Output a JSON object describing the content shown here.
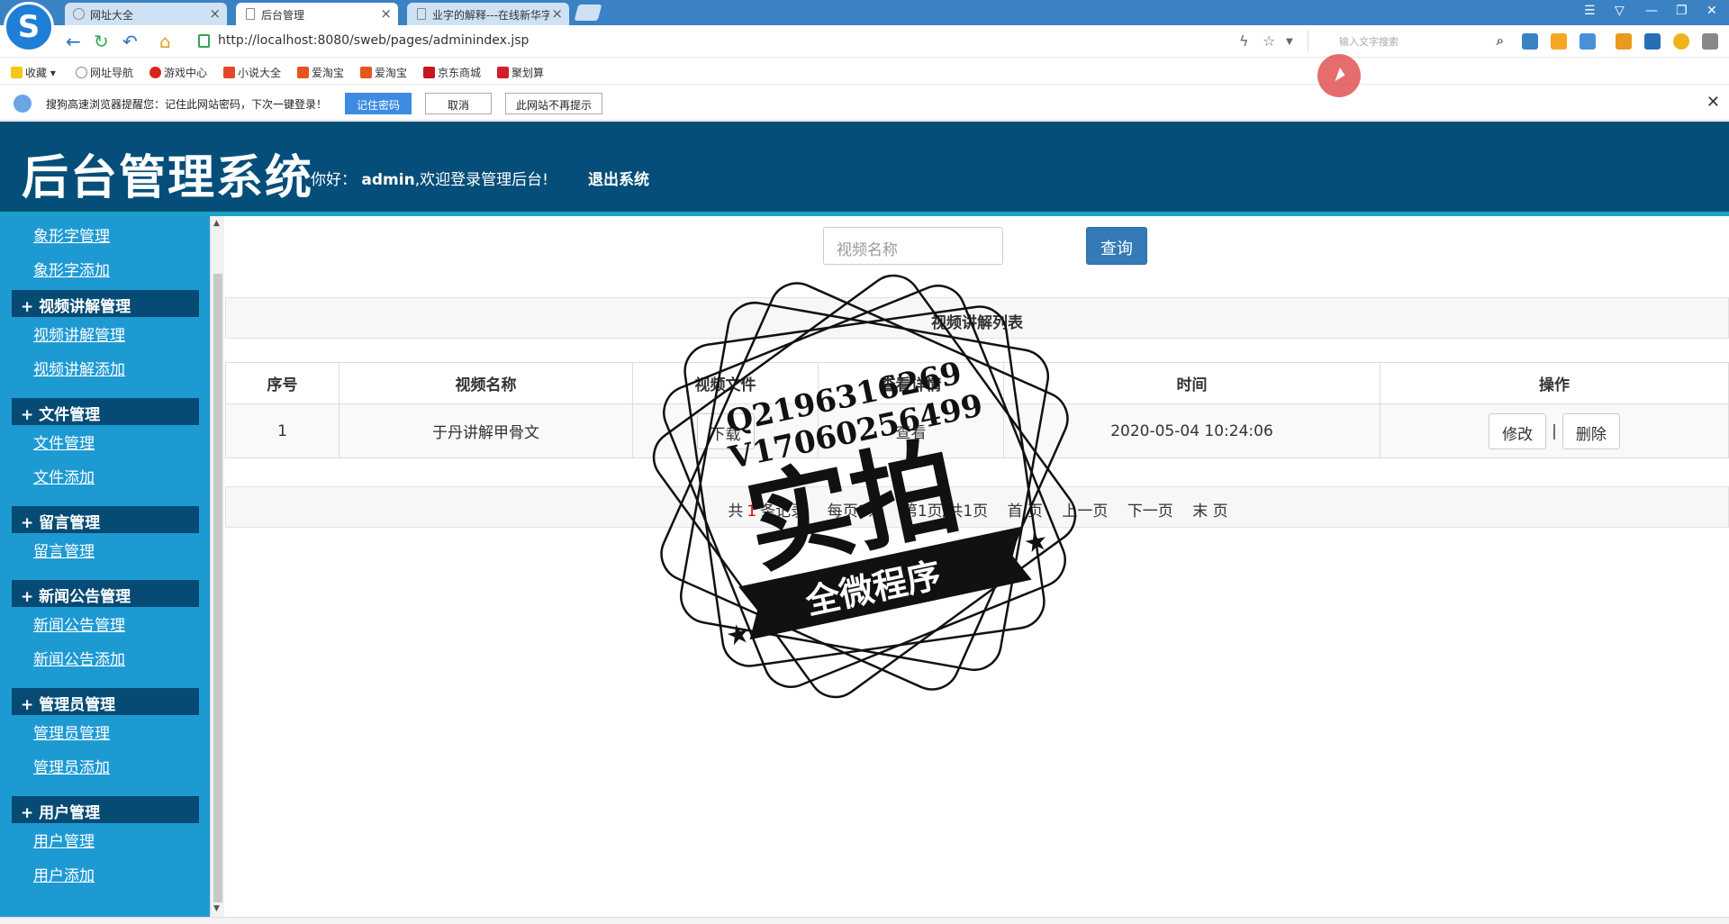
{
  "browser": {
    "tabs": [
      {
        "label": "网址大全",
        "active": false
      },
      {
        "label": "后台管理",
        "active": true
      },
      {
        "label": "业字的解释---在线新华字",
        "active": false
      }
    ],
    "url": "http://localhost:8080/sweb/pages/adminindex.jsp",
    "search_placeholder": "输入文字搜索",
    "bookmarks": [
      "收藏",
      "网址导航",
      "游戏中心",
      "小说大全",
      "爱淘宝",
      "爱淘宝",
      "京东商城",
      "聚划算"
    ],
    "notify": {
      "message": "搜狗高速浏览器提醒您：记住此网站密码，下次一键登录！",
      "remember_label": "记住密码",
      "cancel_label": "取消",
      "never_label": "此网站不再提示"
    }
  },
  "header": {
    "title": "后台管理系统",
    "greeting_prefix": "你好：",
    "username": "admin",
    "greeting_suffix": ",欢迎登录管理后台!",
    "logout_label": "退出系统"
  },
  "sidebar": {
    "top_links": [
      "象形字管理",
      "象形字添加"
    ],
    "groups": [
      {
        "title": "视频讲解管理",
        "links": [
          "视频讲解管理",
          "视频讲解添加"
        ]
      },
      {
        "title": "文件管理",
        "links": [
          "文件管理",
          "文件添加"
        ]
      },
      {
        "title": "留言管理",
        "links": [
          "留言管理"
        ]
      },
      {
        "title": "新闻公告管理",
        "links": [
          "新闻公告管理",
          "新闻公告添加"
        ]
      },
      {
        "title": "管理员管理",
        "links": [
          "管理员管理",
          "管理员添加"
        ]
      },
      {
        "title": "用户管理",
        "links": [
          "用户管理",
          "用户添加"
        ]
      }
    ]
  },
  "main": {
    "search_placeholder": "视频名称",
    "query_label": "查询",
    "caption": "视频讲解列表",
    "columns": [
      "序号",
      "视频名称",
      "视频文件",
      "查看详情",
      "时间",
      "操作"
    ],
    "rows": [
      {
        "index": "1",
        "name": "于丹讲解甲骨文",
        "file_action": "下载",
        "detail_action": "查看",
        "time": "2020-05-04 10:24:06",
        "edit_label": "修改",
        "delete_label": "删除"
      }
    ],
    "pager": {
      "total_prefix": "共",
      "total_count": "1",
      "total_suffix": "条记录",
      "per_page": "每页1条",
      "page_info": "第1页/共1页",
      "first": "首 页",
      "prev": "上一页",
      "next": "下一页",
      "last": "末 页"
    }
  },
  "watermark": {
    "line1": "Q2196316269",
    "line2": "V17060256499",
    "big_text": "实拍",
    "banner_text": "全微程序"
  },
  "colors": {
    "header_bg": "#044e79",
    "sidebar_bg": "#1e9ad3",
    "sidebar_group_bg": "#064b74",
    "primary_button": "#337ab7"
  }
}
